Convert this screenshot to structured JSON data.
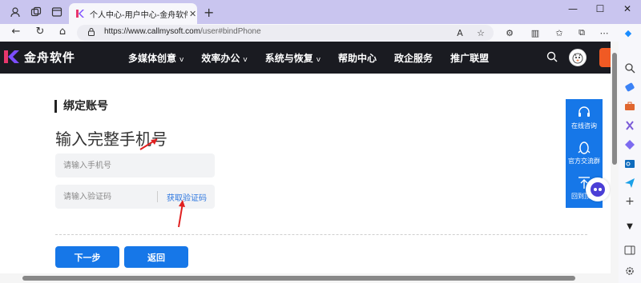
{
  "browser": {
    "tab_title": "个人中心-用户中心-金舟软件",
    "tab_close": "✕",
    "new_tab": "+",
    "url_host": "https://www.callmysoft.com",
    "url_path": "/user#bindPhone",
    "reader_label": "A",
    "window_controls": {
      "minimize": "—",
      "maximize": "☐",
      "close": "✕"
    }
  },
  "site": {
    "brand": "金舟软件",
    "nav": [
      {
        "label": "多媒体创意",
        "dropdown": "v"
      },
      {
        "label": "效率办公",
        "dropdown": "v"
      },
      {
        "label": "系统与恢复",
        "dropdown": "v"
      },
      {
        "label": "帮助中心"
      },
      {
        "label": "政企服务"
      },
      {
        "label": "推广联盟"
      }
    ]
  },
  "main": {
    "section_title": "绑定账号",
    "heading": "输入完整手机号",
    "phone_placeholder": "请输入手机号",
    "code_placeholder": "请输入验证码",
    "get_code": "获取验证码",
    "next_button": "下一步",
    "back_button": "返回"
  },
  "float_bar": {
    "items": [
      "在线咨询",
      "官方交流群",
      "回到顶部"
    ]
  },
  "colors": {
    "accent": "#1677e8",
    "header_bg": "#1a1b21",
    "browser_frame": "#c9c5ef"
  }
}
